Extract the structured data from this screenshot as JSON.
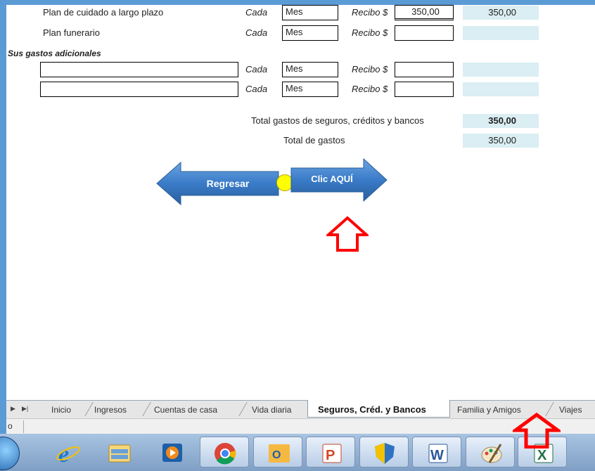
{
  "rows": [
    {
      "label": "Plan de cuidado a largo plazo",
      "cada": "Cada",
      "freq": "Mes",
      "recibo": "Recibo $",
      "amount": "350,00",
      "result": "350,00"
    },
    {
      "label": "Plan funerario",
      "cada": "Cada",
      "freq": "Mes",
      "recibo": "Recibo $",
      "amount": "",
      "result": ""
    }
  ],
  "additional": {
    "heading": "Sus gastos adicionales",
    "rows": [
      {
        "label": "",
        "cada": "Cada",
        "freq": "Mes",
        "recibo": "Recibo $",
        "amount": "",
        "result": ""
      },
      {
        "label": "",
        "cada": "Cada",
        "freq": "Mes",
        "recibo": "Recibo $",
        "amount": "",
        "result": ""
      }
    ]
  },
  "totals": {
    "insurance_label": "Total gastos de seguros, créditos y bancos",
    "insurance_value": "350,00",
    "total_label": "Total de gastos",
    "total_value": "350,00"
  },
  "nav": {
    "back_label": "Regresar",
    "next_label": "Clic AQUÍ"
  },
  "tabs": {
    "items": [
      "Inicio",
      "Ingresos",
      "Cuentas de casa",
      "Vida diaria",
      "Seguros, Créd. y Bancos",
      "Familia y Amigos",
      "Viajes"
    ],
    "active": "Seguros, Créd. y Bancos"
  },
  "status_text": "o",
  "taskbar_apps": [
    "start-orb-icon",
    "internet-explorer-icon",
    "file-explorer-icon",
    "media-player-icon",
    "chrome-icon",
    "outlook-icon",
    "powerpoint-icon",
    "security-shield-icon",
    "word-icon",
    "paint-icon",
    "excel-icon"
  ],
  "colors": {
    "arrow_blue": "#3a7bc8",
    "highlight_cell": "#daeef3",
    "pointer_red": "#ff0000",
    "yellow_dot": "#ffff00"
  }
}
